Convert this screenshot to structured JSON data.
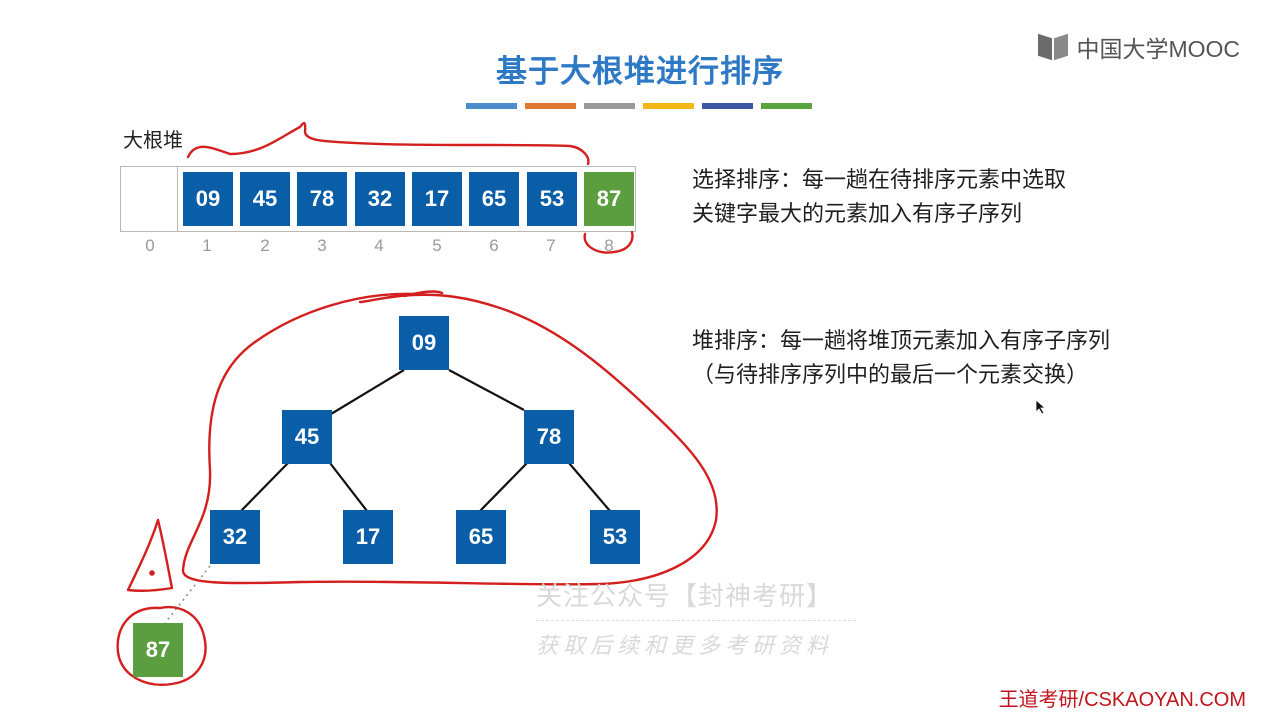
{
  "slide": {
    "title": "基于大根堆进行排序",
    "bar_colors": [
      "#4a8ccc",
      "#e1782f",
      "#9a9a9a",
      "#f3b71a",
      "#3a58a4",
      "#5aa33f"
    ],
    "logo_text": "中国大学MOOC"
  },
  "array": {
    "label": "大根堆",
    "indices": [
      "0",
      "1",
      "2",
      "3",
      "4",
      "5",
      "6",
      "7",
      "8"
    ],
    "cells": [
      "",
      "09",
      "45",
      "78",
      "32",
      "17",
      "65",
      "53",
      "87"
    ]
  },
  "tree": {
    "levels": [
      [
        "09"
      ],
      [
        "45",
        "78"
      ],
      [
        "32",
        "17",
        "65",
        "53"
      ]
    ],
    "removed": "87"
  },
  "text": {
    "selection_line1": "选择排序：每一趟在待排序元素中选取",
    "selection_line2": "关键字最大的元素加入有序子序列",
    "heap_line1": "堆排序：每一趟将堆顶元素加入有序子序列",
    "heap_line2": "（与待排序序列中的最后一个元素交换）"
  },
  "watermark": {
    "line1": "关注公众号【封神考研】",
    "line2": "获取后续和更多考研资料"
  },
  "footer": "王道考研/CSKAOYAN.COM",
  "colors": {
    "node_blue": "#0a5ea8",
    "node_green": "#5b9e3f",
    "annotation_red": "#d41f1f",
    "title_blue": "#2d79c5"
  }
}
